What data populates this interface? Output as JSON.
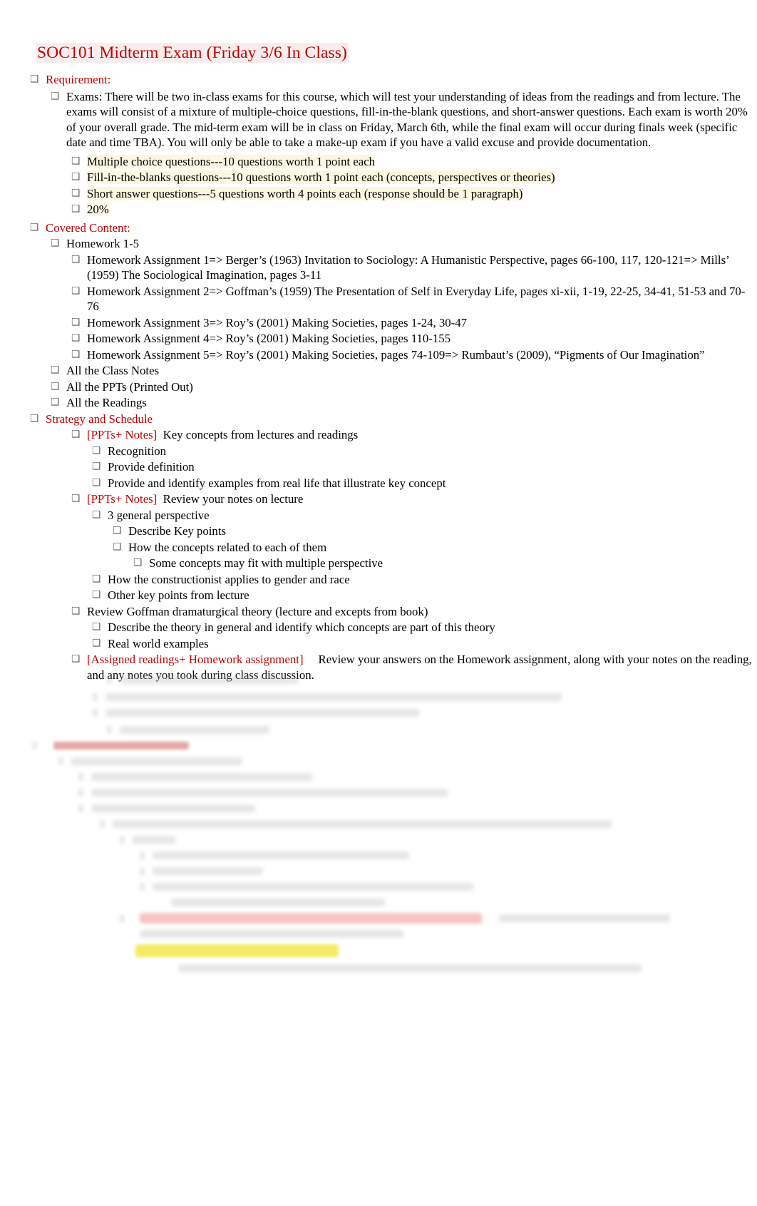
{
  "document": {
    "title": "SOC101 Midterm Exam (Friday 3/6 In Class)",
    "bullet_glyph": "❑"
  },
  "sections": {
    "requirement": {
      "heading": "Requirement:",
      "exams_paragraph": "Exams: There will be two in-class exams for this course, which will test your understanding of ideas from the readings and from lecture. The exams will consist of a mixture of multiple-choice questions, fill-in-the-blank questions, and short-answer questions. Each exam is worth 20% of your overall grade. The mid-term exam will be in class on Friday, March 6th, while the final exam will occur during finals week (specific date and time TBA). You will only be able to take a make-up exam if you have a valid excuse and provide documentation.",
      "breakdown": [
        "Multiple choice questions---10 questions worth 1 point each",
        "Fill-in-the-blanks questions---10 questions worth 1 point each (concepts, perspectives or theories)",
        "Short answer questions---5 questions worth 4 points each (response should be 1 paragraph)",
        "20%"
      ]
    },
    "covered_content": {
      "heading": "Covered Content:",
      "homework_group_label": "Homework 1-5",
      "homework_items": [
        "Homework Assignment 1=> Berger’s (1963) Invitation to Sociology: A Humanistic Perspective, pages 66-100, 117, 120-121=> Mills’ (1959) The Sociological Imagination, pages 3-11",
        "Homework Assignment 2=> Goffman’s (1959) The Presentation of Self in Everyday Life, pages xi-xii, 1-19, 22-25, 34-41, 51-53 and 70-76",
        "Homework Assignment 3=> Roy’s (2001) Making Societies, pages 1-24, 30-47",
        "Homework Assignment 4=>  Roy’s (2001) Making Societies, pages 110-155",
        "Homework Assignment 5=> Roy’s (2001) Making Societies, pages 74-109=>  Rumbaut’s (2009), “Pigments of Our Imagination”"
      ],
      "other_items": [
        "All the Class Notes",
        "All the PPTs (Printed Out)",
        "All the Readings"
      ]
    },
    "strategy": {
      "heading": "Strategy and Schedule",
      "item1": {
        "tag": "[PPTs+ Notes]",
        "text": "Key concepts from lectures and readings",
        "children": [
          "Recognition",
          "Provide definition",
          "Provide and identify examples from real life that illustrate key concept"
        ]
      },
      "item2": {
        "tag": "[PPTs+ Notes]",
        "text": "Review your notes on lecture",
        "child_group_label": "3 general perspective",
        "child_group_items": [
          "Describe Key points",
          "How the concepts related to each of them"
        ],
        "grandchild": "Some concepts may fit with multiple perspective",
        "siblings": [
          "How the constructionist applies to gender and race",
          "Other key points from lecture"
        ]
      },
      "item3": {
        "text": "Review Goffman dramaturgical theory (lecture and excepts from book)",
        "children": [
          "Describe the theory in general and identify which concepts are part of this theory",
          "Real world examples"
        ]
      },
      "item4": {
        "tag": "[Assigned readings+ Homework assignment]",
        "text": "Review your answers on the Homework assignment, along with your notes on the reading, and any notes you took during class discussion."
      }
    }
  },
  "colors": {
    "heading_red": "#c00000",
    "body_black": "#000000",
    "highlight_yellow": "#fff29a",
    "highlight_cream": "#faf8de",
    "highlight_pink": "#e9cccc"
  }
}
